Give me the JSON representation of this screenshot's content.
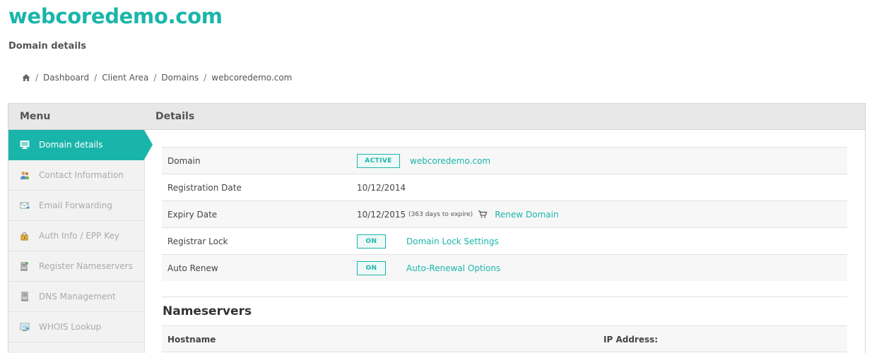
{
  "header": {
    "site_title": "webcoredemo.com",
    "subtitle": "Domain details"
  },
  "breadcrumb": {
    "items": [
      "Dashboard",
      "Client Area",
      "Domains",
      "webcoredemo.com"
    ],
    "separator": "/",
    "home_icon": "home-icon"
  },
  "panel": {
    "menu_title": "Menu",
    "details_title": "Details"
  },
  "sidebar": {
    "items": [
      {
        "label": "Domain details",
        "icon": "monitor-icon",
        "active": true
      },
      {
        "label": "Contact Information",
        "icon": "contacts-icon",
        "active": false
      },
      {
        "label": "Email Forwarding",
        "icon": "email-forward-icon",
        "active": false
      },
      {
        "label": "Auth Info / EPP Key",
        "icon": "lock-key-icon",
        "active": false
      },
      {
        "label": "Register Nameservers",
        "icon": "server-add-icon",
        "active": false
      },
      {
        "label": "DNS Management",
        "icon": "server-icon",
        "active": false
      },
      {
        "label": "WHOIS Lookup",
        "icon": "whois-icon",
        "active": false
      }
    ]
  },
  "details": {
    "domain": {
      "label": "Domain",
      "status": "ACTIVE",
      "value": "webcoredemo.com"
    },
    "registration": {
      "label": "Registration Date",
      "value": "10/12/2014"
    },
    "expiry": {
      "label": "Expiry Date",
      "value": "10/12/2015",
      "note": "(363 days to expire)",
      "renew_label": "Renew Domain"
    },
    "registrar_lock": {
      "label": "Registrar Lock",
      "status": "ON",
      "link": "Domain Lock Settings"
    },
    "auto_renew": {
      "label": "Auto Renew",
      "status": "ON",
      "link": "Auto-Renewal Options"
    }
  },
  "nameservers": {
    "title": "Nameservers",
    "columns": [
      "Hostname",
      "IP Address:"
    ]
  },
  "colors": {
    "accent": "#1ab5aa",
    "sidebar_bg": "#f2f2f2",
    "panel_head_bg": "#e8e8e8"
  }
}
